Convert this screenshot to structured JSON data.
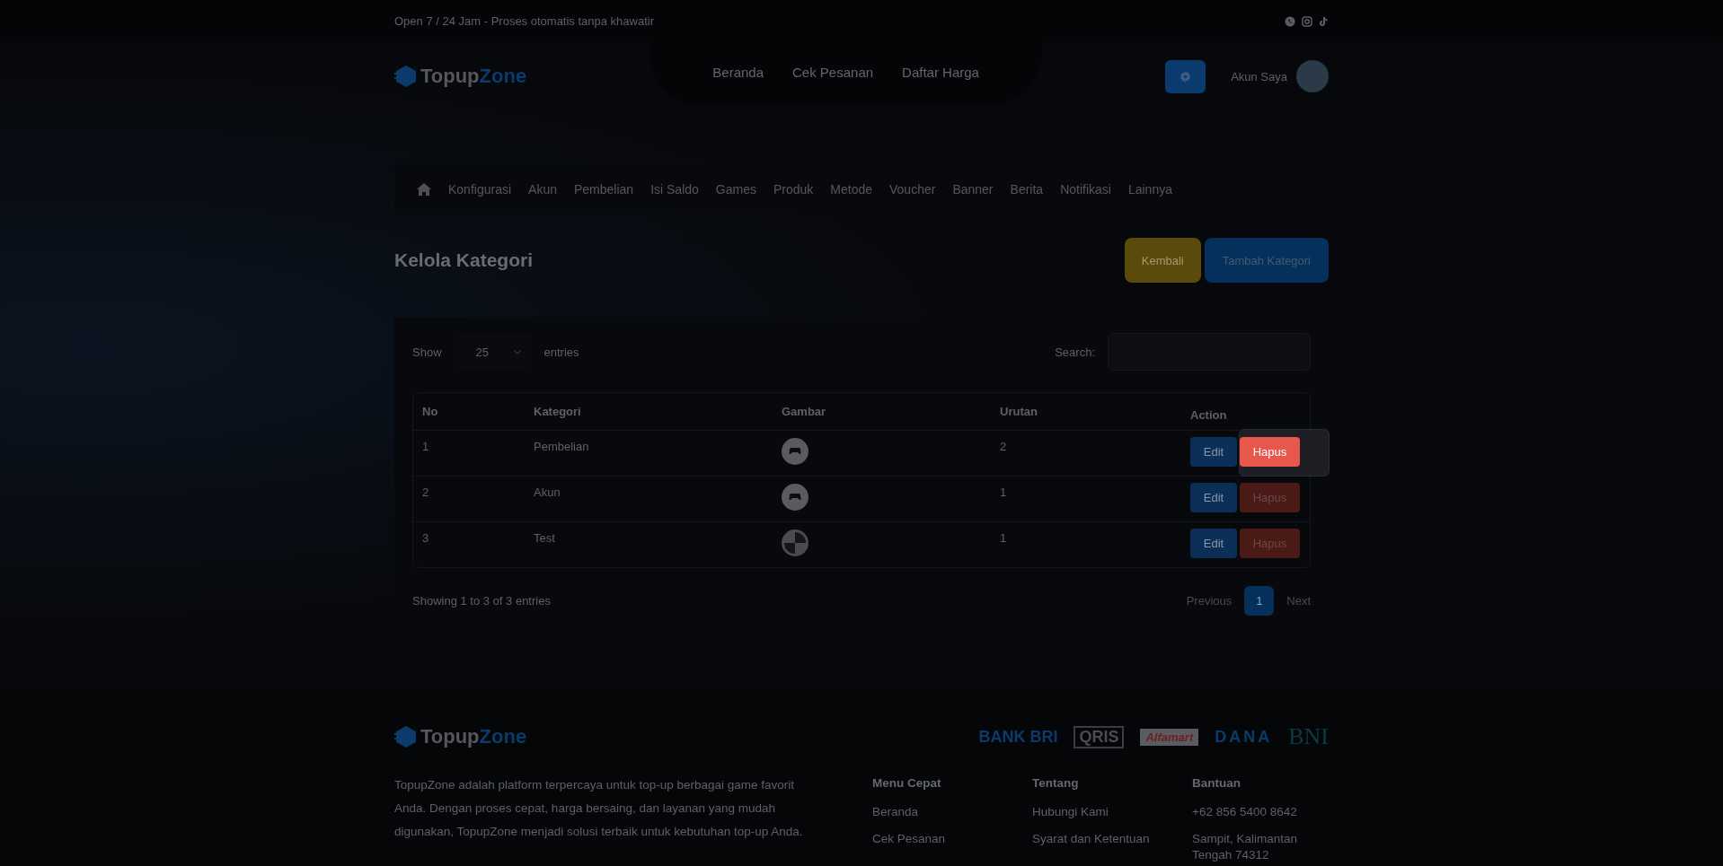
{
  "top_bar": {
    "text": "Open 7 / 24 Jam - Proses otomatis tanpa khawatir"
  },
  "header": {
    "logo": {
      "first": "Topup",
      "second": "Zone"
    },
    "nav": [
      "Beranda",
      "Cek Pesanan",
      "Daftar Harga"
    ],
    "account": "Akun Saya"
  },
  "admin_menu": [
    "Konfigurasi",
    "Akun",
    "Pembelian",
    "Isi Saldo",
    "Games",
    "Produk",
    "Metode",
    "Voucher",
    "Banner",
    "Berita",
    "Notifikasi",
    "Lainnya"
  ],
  "page": {
    "title": "Kelola Kategori",
    "buttons": [
      {
        "label": "Kembali",
        "kind": "back"
      },
      {
        "label": "Tambah Kategori",
        "kind": "add"
      }
    ]
  },
  "table_controls": {
    "show_label": "Show",
    "entries_value": "25",
    "entries_label": "entries",
    "search_label": "Search:"
  },
  "table": {
    "columns": [
      "No",
      "Kategori",
      "Gambar",
      "Urutan",
      "Action"
    ],
    "rows": [
      {
        "no": "1",
        "kategori": "Pembelian",
        "kind": "gamepad",
        "urutan": "2",
        "edit": "Edit",
        "delete": "Hapus",
        "spotlight": true
      },
      {
        "no": "2",
        "kategori": "Akun",
        "kind": "gamepad",
        "urutan": "1",
        "edit": "Edit",
        "delete": "Hapus",
        "spotlight": false
      },
      {
        "no": "3",
        "kategori": "Test",
        "kind": "pattern",
        "urutan": "1",
        "edit": "Edit",
        "delete": "Hapus",
        "spotlight": false
      }
    ]
  },
  "info": "Showing 1 to 3 of 3 entries",
  "pagination": {
    "previous": "Previous",
    "pages": [
      {
        "label": "1",
        "selected": true
      }
    ],
    "next": "Next"
  },
  "footer": {
    "logo": {
      "first": "Topup",
      "second": "Zone"
    },
    "payment_logos": [
      "BANK BRI",
      "QRIS",
      "Alfamart",
      "DANA",
      "BNI"
    ],
    "description": "TopupZone adalah platform terpercaya untuk top-up berbagai game favorit Anda. Dengan proses cepat, harga bersaing, dan layanan yang mudah digunakan, TopupZone menjadi solusi terbaik untuk kebutuhan top-up Anda.",
    "columns": [
      {
        "title": "Menu Cepat",
        "links": [
          "Beranda",
          "Cek Pesanan"
        ]
      },
      {
        "title": "Tentang",
        "links": [
          "Hubungi Kami",
          "Syarat dan Ketentuan"
        ]
      },
      {
        "title": "Bantuan",
        "links": [
          "+62 856 5400 8642",
          "Sampit, Kalimantan Tengah 74312"
        ]
      }
    ]
  }
}
